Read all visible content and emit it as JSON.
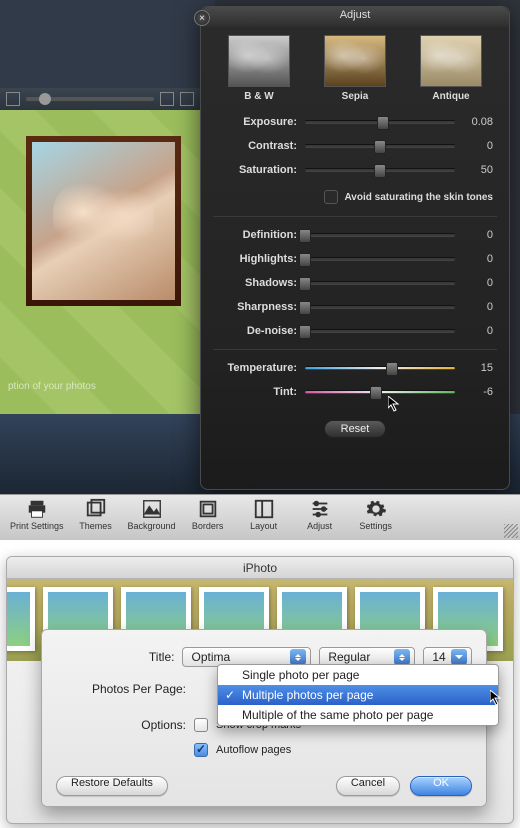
{
  "adjust_panel": {
    "title": "Adjust",
    "presets": [
      {
        "label": "B & W"
      },
      {
        "label": "Sepia"
      },
      {
        "label": "Antique"
      }
    ],
    "group1": [
      {
        "label": "Exposure:",
        "value": "0.08",
        "pos": 52
      },
      {
        "label": "Contrast:",
        "value": "0",
        "pos": 50
      },
      {
        "label": "Saturation:",
        "value": "50",
        "pos": 50
      }
    ],
    "avoid_label": "Avoid saturating the skin tones",
    "group2": [
      {
        "label": "Definition:",
        "value": "0",
        "pos": 0
      },
      {
        "label": "Highlights:",
        "value": "0",
        "pos": 0
      },
      {
        "label": "Shadows:",
        "value": "0",
        "pos": 0
      },
      {
        "label": "Sharpness:",
        "value": "0",
        "pos": 0
      },
      {
        "label": "De-noise:",
        "value": "0",
        "pos": 0
      }
    ],
    "group3": [
      {
        "label": "Temperature:",
        "value": "15",
        "pos": 58,
        "class": "temp"
      },
      {
        "label": "Tint:",
        "value": "-6",
        "pos": 47,
        "class": "tint"
      }
    ],
    "reset_label": "Reset"
  },
  "photos_caption": "ption of your photos",
  "toolbar": [
    {
      "label": "Print Settings",
      "icon": "printer-icon"
    },
    {
      "label": "Themes",
      "icon": "themes-icon"
    },
    {
      "label": "Background",
      "icon": "background-icon"
    },
    {
      "label": "Borders",
      "icon": "borders-icon"
    },
    {
      "label": "Layout",
      "icon": "layout-icon"
    },
    {
      "label": "Adjust",
      "icon": "adjust-icon"
    },
    {
      "label": "Settings",
      "icon": "settings-icon"
    }
  ],
  "lower": {
    "window_title": "iPhoto",
    "title_label": "Title:",
    "title_font": "Optima",
    "title_weight": "Regular",
    "title_size": "14",
    "ppp_label": "Photos Per Page:",
    "options_label": "Options:",
    "opt1": "Show crop marks",
    "opt2": "Autoflow pages",
    "dropdown_items": [
      "Single photo per page",
      "Multiple photos per page",
      "Multiple of the same photo per page"
    ],
    "restore_label": "Restore Defaults",
    "cancel_label": "Cancel",
    "ok_label": "OK"
  }
}
